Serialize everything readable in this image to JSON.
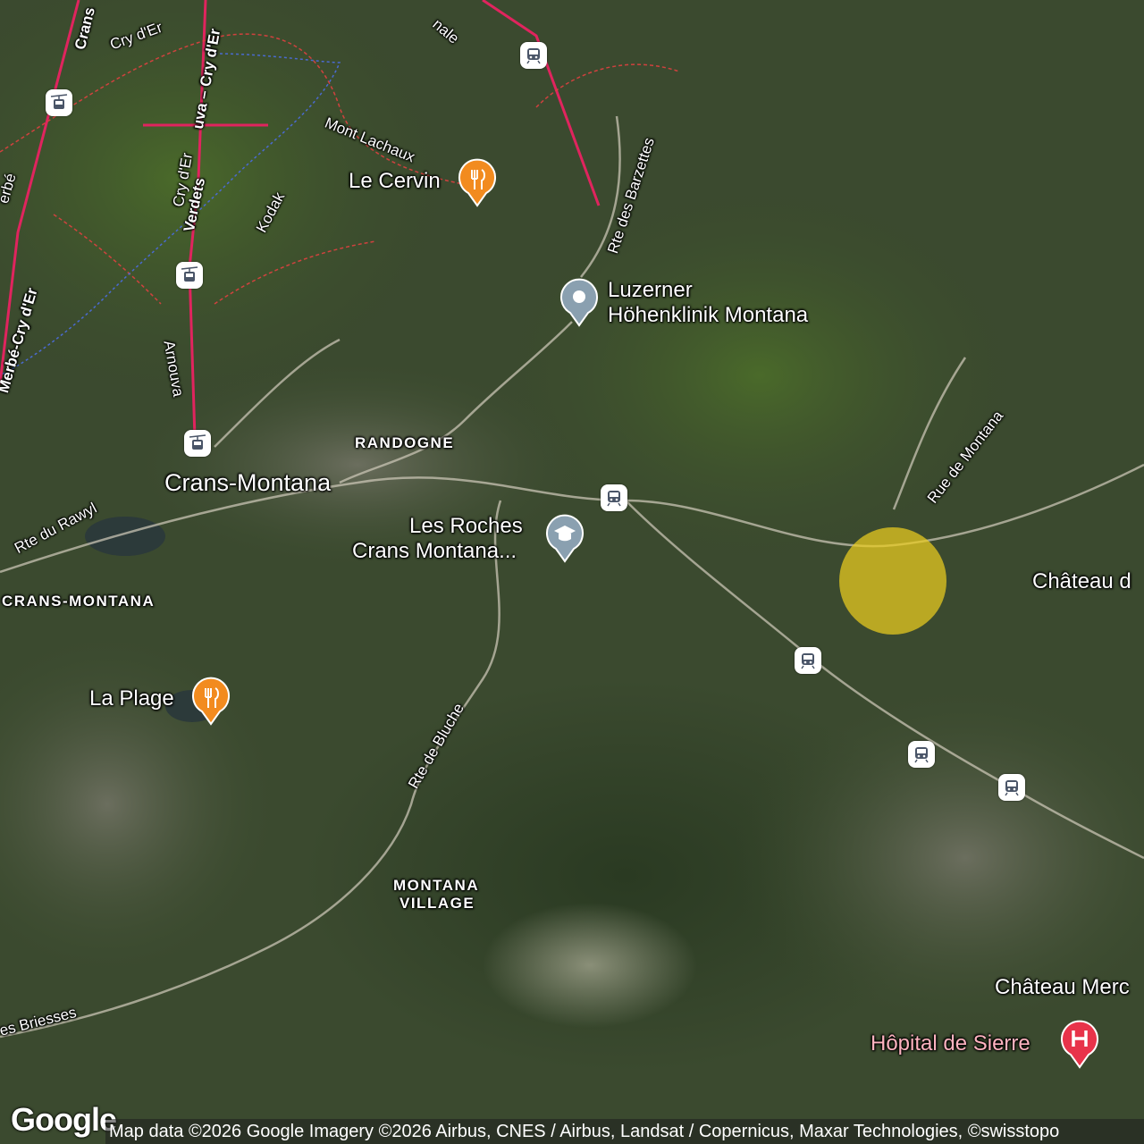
{
  "map": {
    "type": "satellite",
    "highlight_color": "#EBCD1E",
    "place_labels": {
      "crans_montana": "Crans-Montana",
      "randogne": "RANDOGNE",
      "crans_montana_caps": "CRANS-MONTANA",
      "montana_village_1": "MONTANA",
      "montana_village_2": "VILLAGE",
      "chateau_d": "Château d",
      "chateau_merc": "Château Merc"
    },
    "road_labels": {
      "rte_du_rawyl": "Rte du Rawyl",
      "rte_de_bluche": "Rte de Bluche",
      "rue_de_montana": "Rue de Montana",
      "rte_des_barzettes": "Rte des Barzettes",
      "les_briesses": "es Briesses",
      "arnouva": "Arnouva",
      "verdets": "Verdets",
      "kodak": "Kodak",
      "cry_der_1": "Cry d'Er",
      "cry_der_2": "Cry d'Er",
      "cry_der_3": "Cry d'Er",
      "mont_lachaux": "Mont Lachaux",
      "merbe_cry_der": "Merbé-Cry d'Er",
      "erbe": "erbé",
      "crans_top": "Crans",
      "uva_cry_der": "uva – Cry d'Er",
      "nale": "nale"
    },
    "pois": [
      {
        "id": "le-cervin",
        "name": "Le Cervin",
        "icon": "restaurant-icon",
        "color": "#F28B1F"
      },
      {
        "id": "la-plage",
        "name": "La Plage",
        "icon": "restaurant-icon",
        "color": "#F28B1F"
      },
      {
        "id": "luzerner",
        "name_line1": "Luzerner",
        "name_line2": "Höhenklinik Montana",
        "icon": "place-pin-icon",
        "color": "#8AA0B0"
      },
      {
        "id": "les-roches",
        "name_line1": "Les Roches",
        "name_line2": "Crans Montana...",
        "icon": "school-icon",
        "color": "#8AA0B0"
      },
      {
        "id": "hopital",
        "name": "Hôpital de Sierre",
        "icon": "hospital-icon",
        "color": "#E8334A"
      }
    ],
    "transit_icons": [
      "cable-car-icon",
      "cable-car-icon",
      "cable-car-icon",
      "train-icon",
      "train-icon",
      "train-icon",
      "train-icon",
      "train-icon"
    ]
  },
  "footer": {
    "logo": "Google",
    "attribution": "Map data ©2026 Google Imagery ©2026 Airbus, CNES / Airbus, Landsat / Copernicus, Maxar Technologies, ©swisstopo"
  }
}
